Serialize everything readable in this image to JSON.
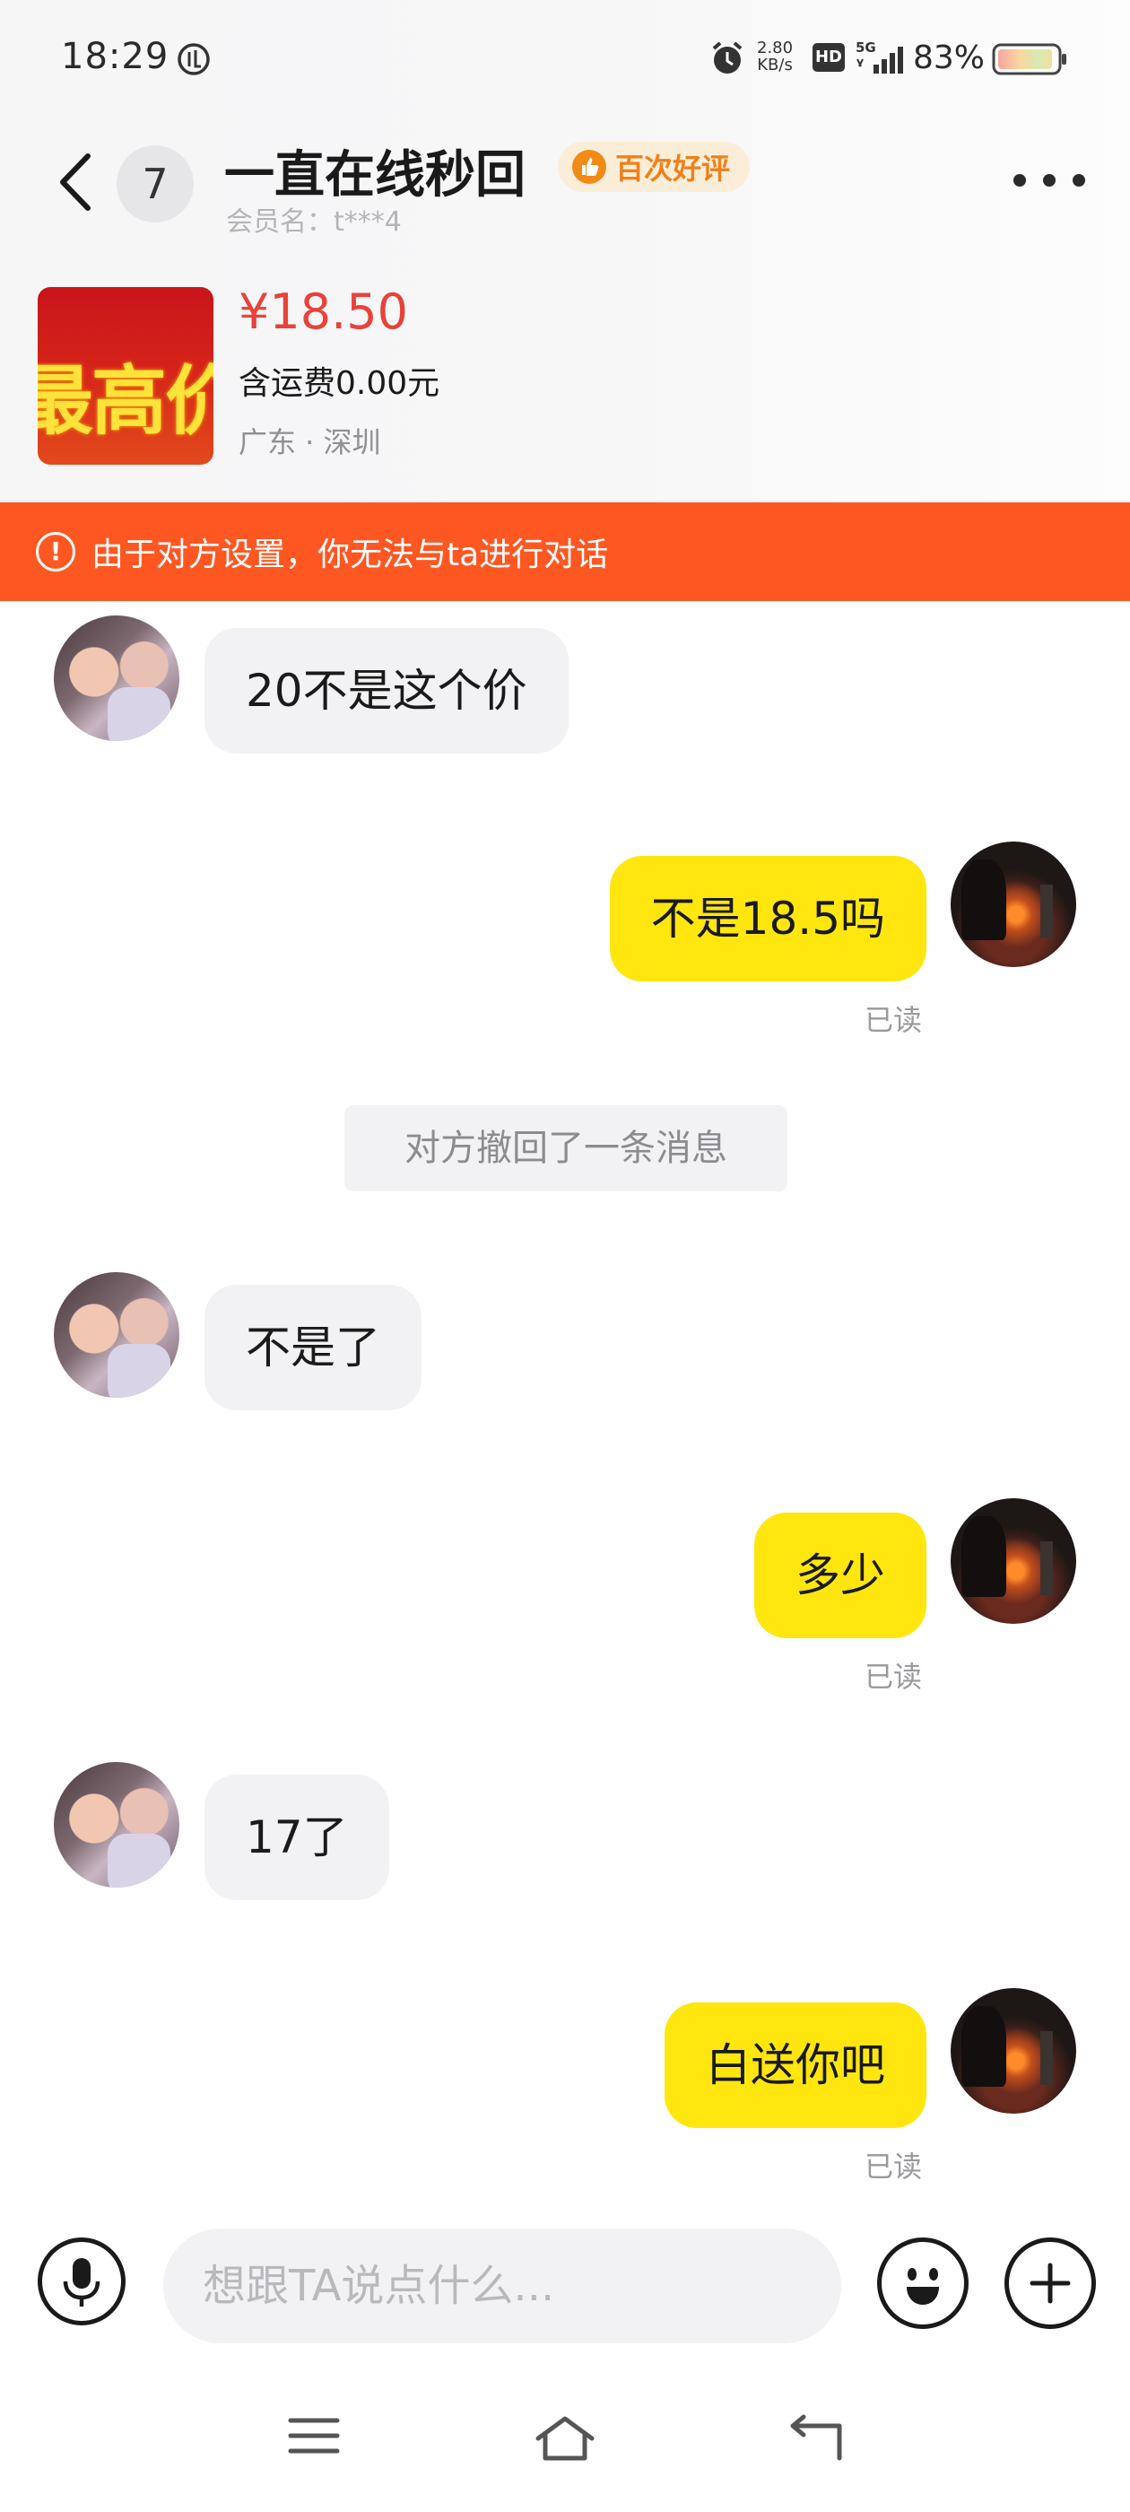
{
  "status_bar": {
    "time": "18:29",
    "net_speed_value": "2.80",
    "net_speed_unit": "KB/s",
    "hd_label": "HD",
    "network": "5G",
    "battery": "83%"
  },
  "header": {
    "unread_count": "7",
    "title": "一直在线秒回",
    "badge": "百次好评",
    "member_label": "会员名：t***4"
  },
  "product": {
    "image_text": "最高价",
    "price": "¥18.50",
    "shipping": "含运费0.00元",
    "location": "广东 · 深圳"
  },
  "warning": {
    "icon": "!",
    "text": "由于对方设置，你无法与ta进行对话"
  },
  "messages": [
    {
      "side": "left",
      "text": "20不是这个价"
    },
    {
      "side": "right",
      "text": "不是18.5吗",
      "status": "已读"
    },
    {
      "side": "system",
      "text": "对方撤回了一条消息"
    },
    {
      "side": "left",
      "text": "不是了"
    },
    {
      "side": "right",
      "text": "多少",
      "status": "已读"
    },
    {
      "side": "left",
      "text": "17了"
    },
    {
      "side": "right",
      "text": "白送你吧",
      "status": "已读"
    }
  ],
  "input": {
    "placeholder": "想跟TA说点什么..."
  },
  "colors": {
    "accent_yellow": "#ffe60f",
    "warning_orange": "#fe5722",
    "price_red": "#e8423a",
    "badge_orange": "#f0801a"
  },
  "icons": [
    "back-arrow-icon",
    "more-icon",
    "warning-icon",
    "mic-icon",
    "emoji-icon",
    "plus-icon",
    "menu-icon",
    "home-icon",
    "back-icon",
    "alarm-icon",
    "signal-icon",
    "battery-icon",
    "thumbs-up-icon"
  ]
}
